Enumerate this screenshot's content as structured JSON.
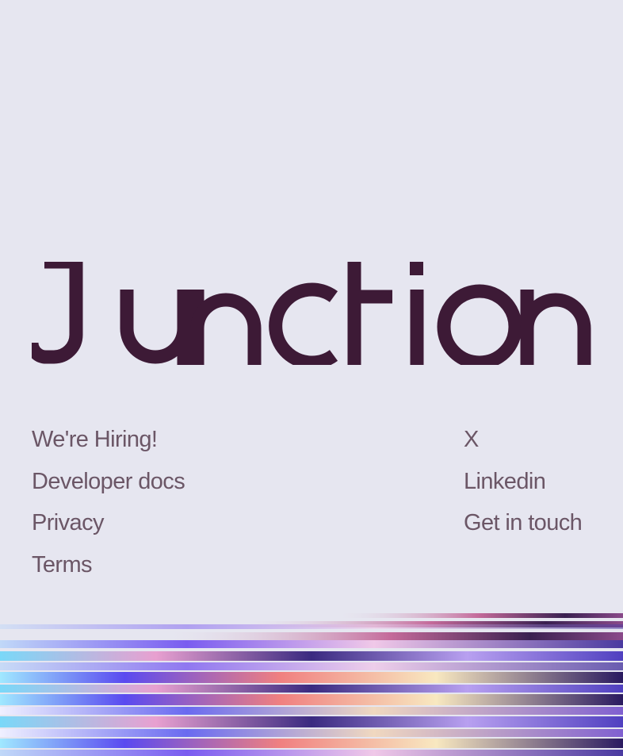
{
  "brand": {
    "name": "Junction",
    "color": "#3d1a36"
  },
  "footer": {
    "left_links": [
      {
        "label": "We're Hiring!"
      },
      {
        "label": "Developer docs"
      },
      {
        "label": "Privacy"
      },
      {
        "label": "Terms"
      }
    ],
    "right_links": [
      {
        "label": "X"
      },
      {
        "label": "Linkedin"
      },
      {
        "label": "Get in touch"
      }
    ],
    "link_color": "#6b5666"
  },
  "background_color": "#e6e6f0"
}
